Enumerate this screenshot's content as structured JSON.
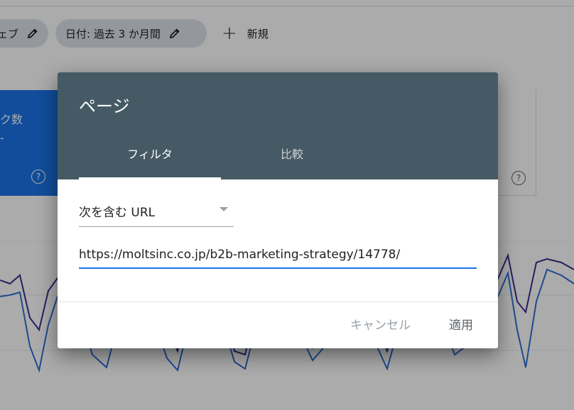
{
  "filter_chips": [
    {
      "label": "ェブ"
    },
    {
      "label": "日付: 過去 3 か月間"
    }
  ],
  "new_button": {
    "label": "新規",
    "icon": "plus-icon"
  },
  "metric_card": {
    "title": "ク数",
    "value": "-"
  },
  "chart_colors": {
    "series_a": "#3c2c8c",
    "series_b": "#2f6fd6"
  },
  "dialog": {
    "title": "ページ",
    "tabs": [
      {
        "label": "フィルタ",
        "active": true
      },
      {
        "label": "比較",
        "active": false
      }
    ],
    "match_type": {
      "selected": "次を含む URL"
    },
    "url_input": {
      "value": "https://moltsinc.co.jp/b2b-marketing-strategy/14778/"
    },
    "cancel_label": "キャンセル",
    "apply_label": "適用"
  },
  "colors": {
    "dialog_header": "#455a64",
    "accent": "#1a73e8",
    "chip_bg": "#dde3ea"
  }
}
